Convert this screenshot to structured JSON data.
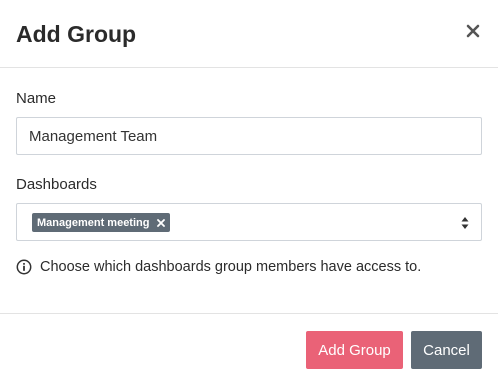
{
  "modal": {
    "title": "Add Group",
    "close_icon": "close-icon"
  },
  "form": {
    "name_label": "Name",
    "name_value": "Management Team",
    "dashboards_label": "Dashboards",
    "selected_dashboards": [
      "Management meeting"
    ],
    "help_text": "Choose which dashboards group members have access to.",
    "help_icon": "info-icon"
  },
  "footer": {
    "submit_label": "Add Group",
    "cancel_label": "Cancel"
  },
  "colors": {
    "primary": "#ea6277",
    "secondary": "#5f6b76",
    "border": "#cfd4da"
  }
}
